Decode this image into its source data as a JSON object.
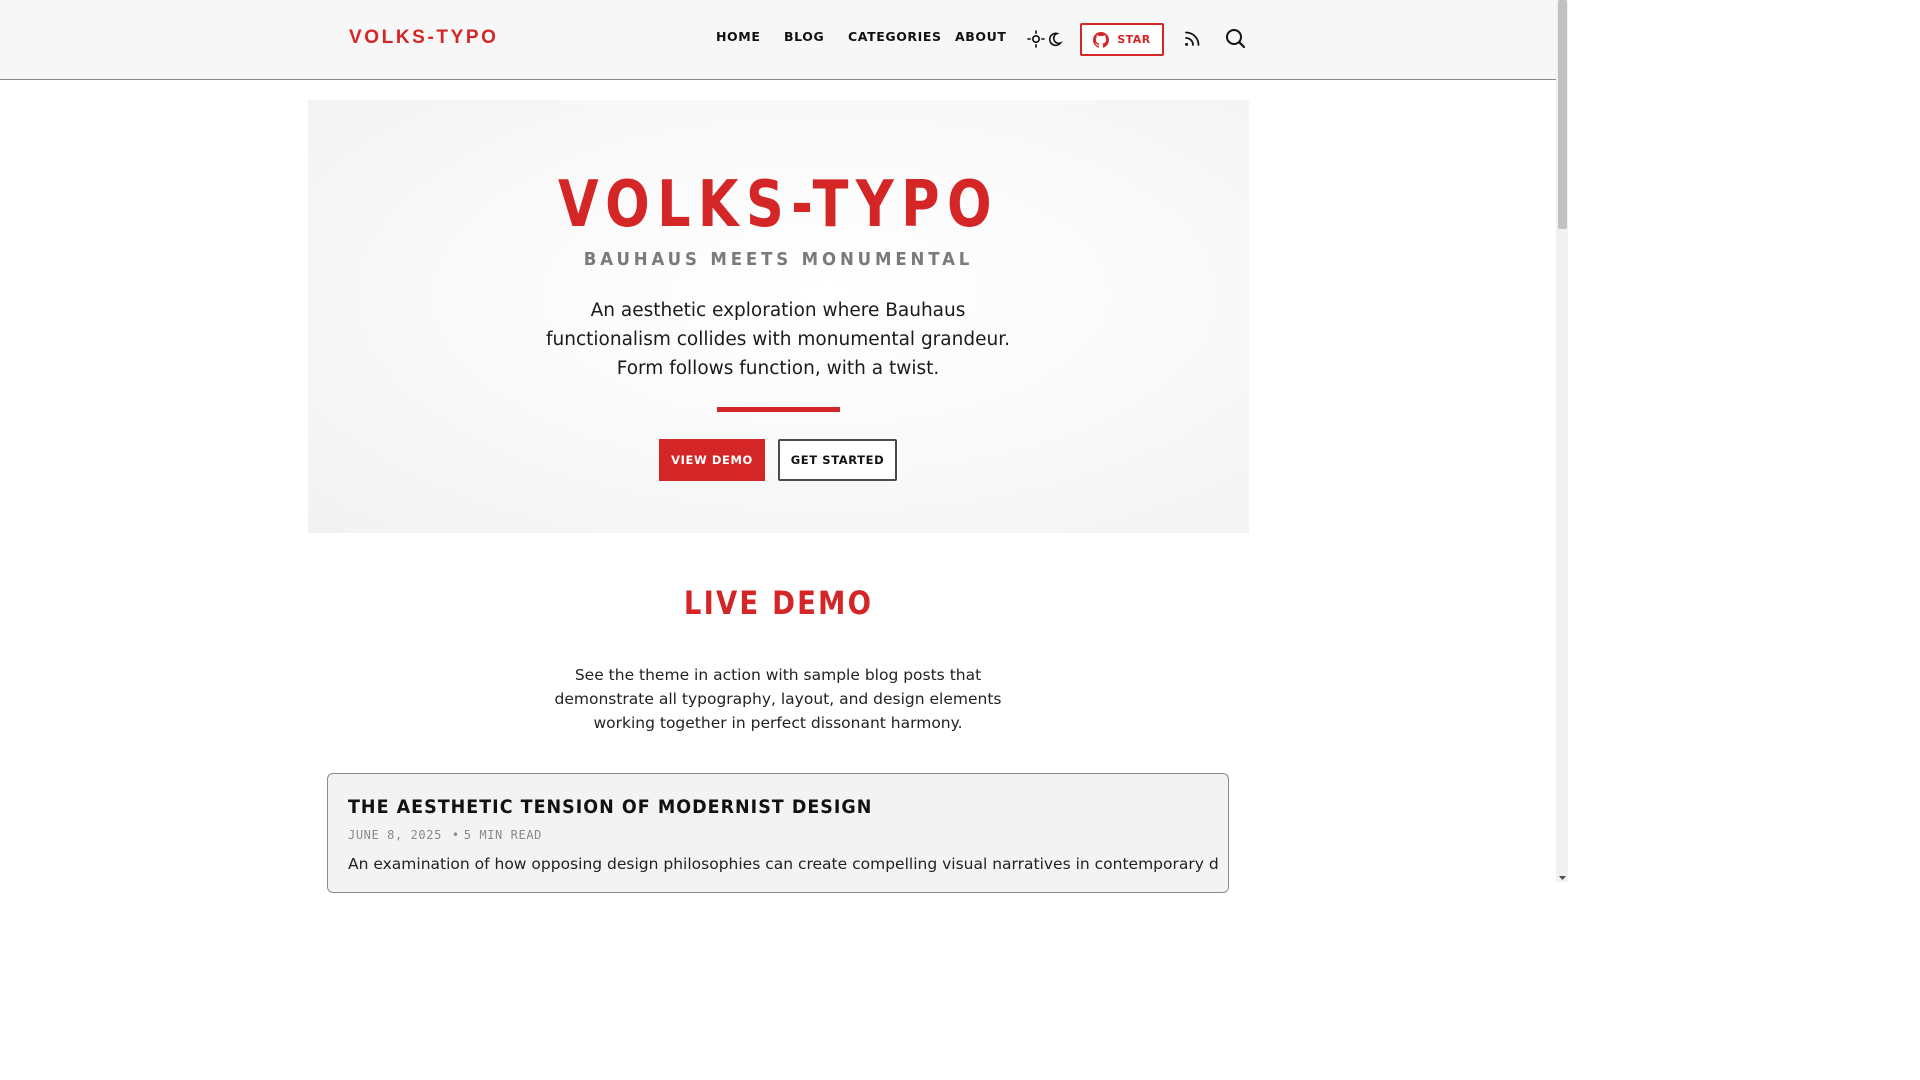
{
  "brand": {
    "logo": "VOLKS-TYPO",
    "accent_color": "#d42626"
  },
  "nav": {
    "items": [
      {
        "label": "HOME"
      },
      {
        "label": "BLOG"
      },
      {
        "label": "CATEGORIES"
      },
      {
        "label": "ABOUT"
      }
    ],
    "theme_toggle_icon": "sun-moon-icon",
    "star_button": {
      "label": "STAR",
      "icon": "github-icon"
    },
    "rss_icon": "rss-icon",
    "search_icon": "search-icon"
  },
  "hero": {
    "title": "VOLKS-TYPO",
    "subtitle": "BAUHAUS MEETS MONUMENTAL",
    "description": "An aesthetic exploration where Bauhaus functionalism collides with monumental grandeur. Form follows function, with a twist.",
    "primary_button": "VIEW DEMO",
    "secondary_button": "GET STARTED"
  },
  "live_demo": {
    "title": "LIVE DEMO",
    "description": "See the theme in action with sample blog posts that demonstrate all typography, layout, and design elements working together in perfect dissonant harmony."
  },
  "posts": [
    {
      "title": "THE AESTHETIC TENSION OF MODERNIST DESIGN",
      "date": "JUNE 8, 2025",
      "separator": "•",
      "read_time": "5 MIN READ",
      "excerpt": "An examination of how opposing design philosophies can create compelling visual narratives in contemporary digital"
    }
  ]
}
